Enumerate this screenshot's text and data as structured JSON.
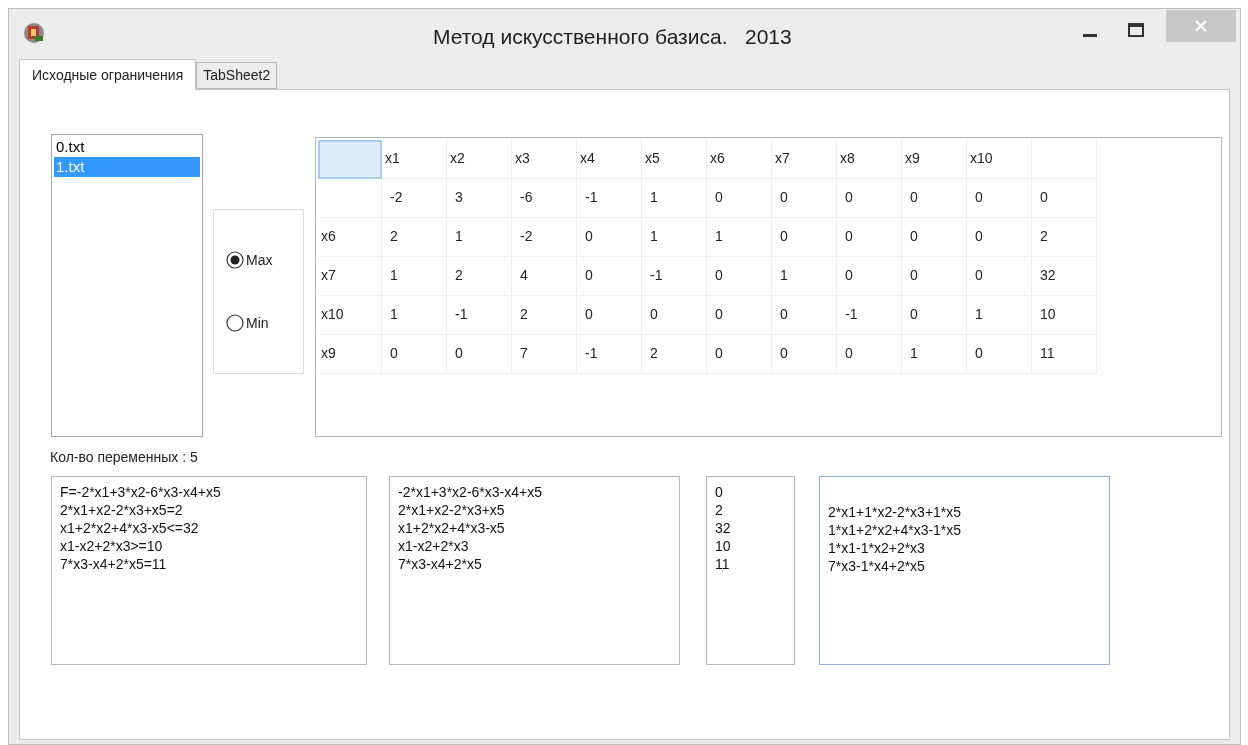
{
  "window": {
    "title": "Метод искусственного базиса.   2013"
  },
  "tabs": [
    {
      "label": "Исходные ограничения",
      "selected": true
    },
    {
      "label": "TabSheet2",
      "selected": false
    }
  ],
  "file_list": {
    "items": [
      {
        "label": "0.txt",
        "selected": false
      },
      {
        "label": "1.txt",
        "selected": true
      }
    ]
  },
  "mode": {
    "options": [
      {
        "label": "Max",
        "selected": true
      },
      {
        "label": "Min",
        "selected": false
      }
    ]
  },
  "table": {
    "corner_selected": true,
    "columns": [
      "x1",
      "x2",
      "x3",
      "x4",
      "x5",
      "x6",
      "x7",
      "x8",
      "x9",
      "x10"
    ],
    "rows": [
      {
        "cells": [
          "-2",
          "3",
          "-6",
          "-1",
          "1",
          "0",
          "0",
          "0",
          "0",
          "0",
          "0"
        ]
      },
      {
        "header": "x6",
        "cells": [
          "2",
          "1",
          "-2",
          "0",
          "1",
          "1",
          "0",
          "0",
          "0",
          "0",
          "2"
        ]
      },
      {
        "header": "x7",
        "cells": [
          "1",
          "2",
          "4",
          "0",
          "-1",
          "0",
          "1",
          "0",
          "0",
          "0",
          "32"
        ]
      },
      {
        "header": "x10",
        "cells": [
          "1",
          "-1",
          "2",
          "0",
          "0",
          "0",
          "0",
          "-1",
          "0",
          "1",
          "10"
        ]
      },
      {
        "header": "x9",
        "cells": [
          "0",
          "0",
          "7",
          "-1",
          "2",
          "0",
          "0",
          "0",
          "1",
          "0",
          "11"
        ]
      }
    ]
  },
  "variable_count_label": "Кол-во переменных : 5",
  "memos": [
    {
      "focused": false,
      "blank_first_line": false,
      "lines": [
        "F=-2*x1+3*x2-6*x3-x4+x5",
        "2*x1+x2-2*x3+x5=2",
        "x1+2*x2+4*x3-x5<=32",
        "x1-x2+2*x3>=10",
        "7*x3-x4+2*x5=11"
      ]
    },
    {
      "focused": false,
      "blank_first_line": false,
      "lines": [
        "-2*x1+3*x2-6*x3-x4+x5",
        "2*x1+x2-2*x3+x5",
        "x1+2*x2+4*x3-x5",
        "x1-x2+2*x3",
        "7*x3-x4+2*x5"
      ]
    },
    {
      "focused": false,
      "blank_first_line": false,
      "lines": [
        "0",
        "2",
        "32",
        "10",
        "11"
      ]
    },
    {
      "focused": true,
      "blank_first_line": true,
      "lines": [
        "2*x1+1*x2-2*x3+1*x5",
        "1*x1+2*x2+4*x3-1*x5",
        "1*x1-1*x2+2*x3",
        "7*x3-1*x4+2*x5"
      ]
    }
  ]
}
